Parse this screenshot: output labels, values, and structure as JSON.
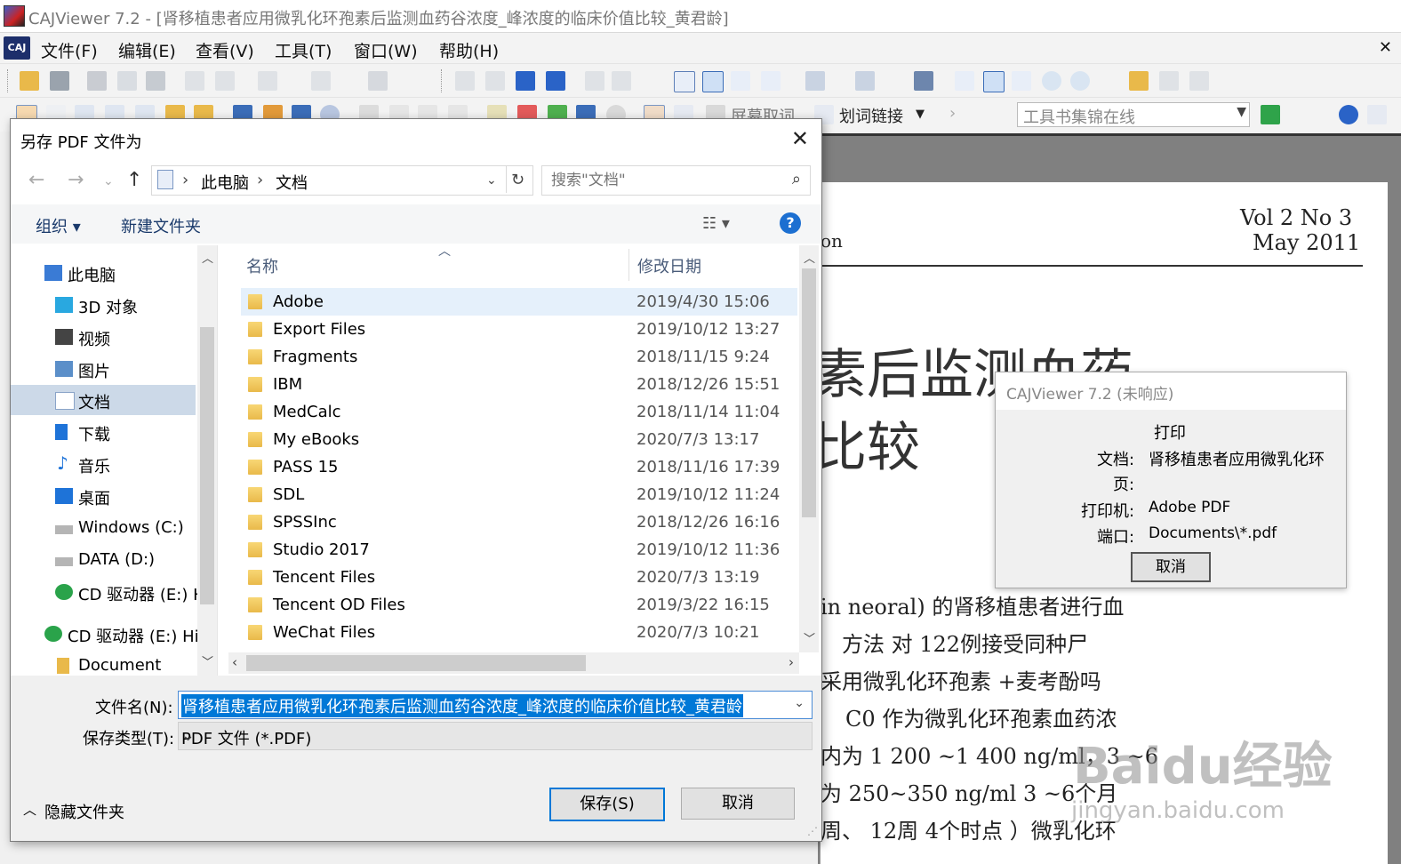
{
  "app": {
    "title": "CAJViewer 7.2 - [肾移植患者应用微乳化环孢素后监测血药谷浓度_峰浓度的临床价值比较_黄君龄]",
    "logo": "CAJ",
    "menus": [
      "文件(F)",
      "编辑(E)",
      "查看(V)",
      "工具(T)",
      "窗口(W)",
      "帮助(H)"
    ],
    "toolbar": {
      "screen_cancel": "屏幕取词",
      "word_link": "划词链接",
      "toolset_placeholder": "工具书集锦在线"
    }
  },
  "document": {
    "vol": "Vol 2  No 3",
    "date": "May 2011",
    "frag_top": "on",
    "title_line1": "素后监测血药",
    "title_line2": "比较",
    "body": [
      "in neoral) 的肾移植患者进行血",
      "方法   对 122例接受同种尸",
      "采用微乳化环孢素 +麦考酚吗",
      "C0 作为微乳化环孢素血药浓",
      "内为 1 200 ~1 400  ng/ml，3 ~6",
      "为 250~350 ng/ml  3 ~6个月",
      "周、 12周 4个时点 ）微乳化环"
    ],
    "watermark": "Baidu经验",
    "watermark_url": "jingyan.baidu.com"
  },
  "print_dialog": {
    "title": "CAJViewer 7.2 (未响应)",
    "heading": "打印",
    "doc_label": "文档:",
    "doc_value": "肾移植患者应用微乳化环",
    "page_label": "页:",
    "printer_label": "打印机:",
    "printer_value": "Adobe PDF",
    "port_label": "端口:",
    "port_value": "Documents\\*.pdf",
    "cancel": "取消"
  },
  "save_dialog": {
    "title": "另存 PDF 文件为",
    "breadcrumb": [
      "此电脑",
      "文档"
    ],
    "search_placeholder": "搜索\"文档\"",
    "organize": "组织 ▾",
    "new_folder": "新建文件夹",
    "nav_items": [
      {
        "label": "此电脑",
        "icon": "computer-icon",
        "color": "#3a7bd5"
      },
      {
        "label": "3D 对象",
        "icon": "cube-3d-icon",
        "color": "#29a8e0"
      },
      {
        "label": "视频",
        "icon": "film-icon",
        "color": "#444444"
      },
      {
        "label": "图片",
        "icon": "picture-icon",
        "color": "#5b8fc9"
      },
      {
        "label": "文档",
        "icon": "document-icon",
        "color": "#8aa4c8"
      },
      {
        "label": "下载",
        "icon": "download-arrow-icon",
        "color": "#1e73d8"
      },
      {
        "label": "音乐",
        "icon": "music-note-icon",
        "color": "#1e73d8"
      },
      {
        "label": "桌面",
        "icon": "desktop-icon",
        "color": "#1e73d8"
      },
      {
        "label": "Windows (C:)",
        "icon": "drive-icon",
        "color": "#888888"
      },
      {
        "label": "DATA (D:)",
        "icon": "drive-icon",
        "color": "#888888"
      },
      {
        "label": "CD 驱动器 (E:) H",
        "icon": "cd-drive-icon",
        "color": "#2aa34a"
      },
      {
        "label": "CD 驱动器 (E:) Hi!",
        "icon": "cd-drive-icon",
        "color": "#2aa34a"
      },
      {
        "label": "Document",
        "icon": "folder-icon",
        "color": "#e9b94a"
      }
    ],
    "columns": {
      "name": "名称",
      "modified": "修改日期"
    },
    "files": [
      {
        "name": "Adobe",
        "date": "2019/4/30 15:06"
      },
      {
        "name": "Export Files",
        "date": "2019/10/12 13:27"
      },
      {
        "name": "Fragments",
        "date": "2018/11/15 9:24"
      },
      {
        "name": "IBM",
        "date": "2018/12/26 15:51"
      },
      {
        "name": "MedCalc",
        "date": "2018/11/14 11:04"
      },
      {
        "name": "My eBooks",
        "date": "2020/7/3 13:17"
      },
      {
        "name": "PASS 15",
        "date": "2018/11/16 17:39"
      },
      {
        "name": "SDL",
        "date": "2019/10/12 11:24"
      },
      {
        "name": "SPSSInc",
        "date": "2018/12/26 16:16"
      },
      {
        "name": "Studio 2017",
        "date": "2019/10/12 11:36"
      },
      {
        "name": "Tencent Files",
        "date": "2020/7/3 13:19"
      },
      {
        "name": "Tencent OD Files",
        "date": "2019/3/22 16:15"
      },
      {
        "name": "WeChat Files",
        "date": "2020/7/3 10:21"
      }
    ],
    "filename_label": "文件名(N):",
    "filename_value": "肾移植患者应用微乳化环孢素后监测血药谷浓度_峰浓度的临床价值比较_黄君龄",
    "filetype_label": "保存类型(T):",
    "filetype_value": "PDF 文件 (*.PDF)",
    "hide_folders": "隐藏文件夹",
    "save": "保存(S)",
    "cancel": "取消"
  }
}
